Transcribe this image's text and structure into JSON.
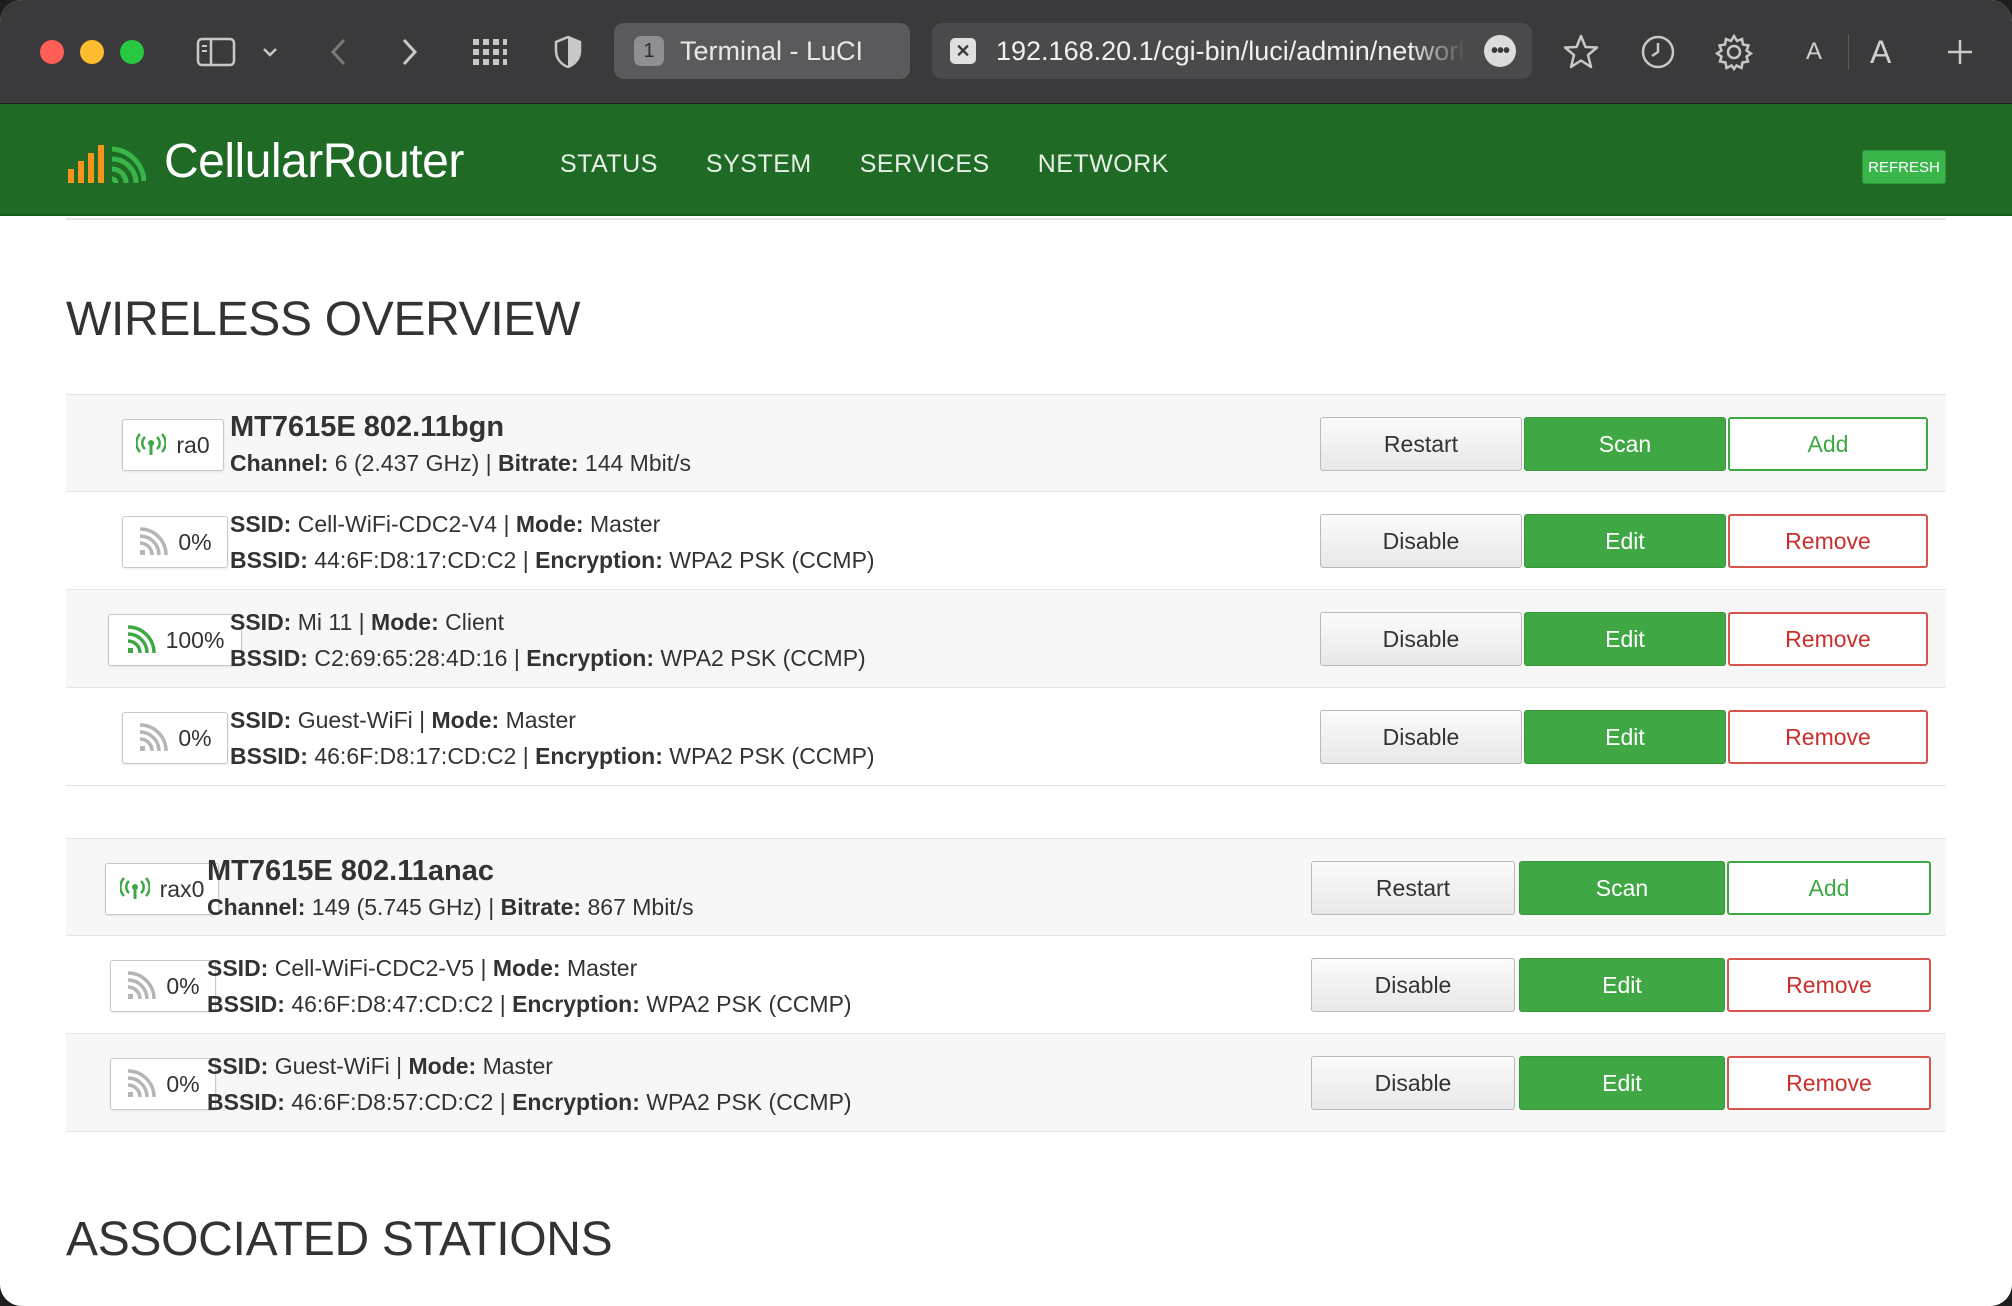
{
  "browser": {
    "tab": {
      "number": "1",
      "title": "Terminal - LuCI"
    },
    "url": "192.168.20.1/cgi-bin/luci/admin/network",
    "font_small": "A",
    "font_large": "A"
  },
  "header": {
    "brand": "CellularRouter",
    "nav": [
      "STATUS",
      "SYSTEM",
      "SERVICES",
      "NETWORK"
    ],
    "refresh": "REFRESH",
    "colors": {
      "bar": "#1f6b26",
      "accent": "#3fa845",
      "danger": "#d9534f"
    }
  },
  "page": {
    "title": "WIRELESS OVERVIEW",
    "stations_title": "ASSOCIATED STATIONS"
  },
  "labels": {
    "channel": "Channel:",
    "bitrate": "Bitrate:",
    "ssid": "SSID:",
    "mode": "Mode:",
    "bssid": "BSSID:",
    "encryption": "Encryption:",
    "restart": "Restart",
    "scan": "Scan",
    "add": "Add",
    "disable": "Disable",
    "edit": "Edit",
    "remove": "Remove"
  },
  "radios": [
    {
      "device": "ra0",
      "name": "MT7615E 802.11bgn",
      "channel": "6 (2.437 GHz)",
      "bitrate": "144 Mbit/s",
      "networks": [
        {
          "signal": "0%",
          "ssid": "Cell-WiFi-CDC2-V4",
          "mode": "Master",
          "bssid": "44:6F:D8:17:CD:C2",
          "encryption": "WPA2 PSK (CCMP)"
        },
        {
          "signal": "100%",
          "ssid": "Mi 11",
          "mode": "Client",
          "bssid": "C2:69:65:28:4D:16",
          "encryption": "WPA2 PSK (CCMP)"
        },
        {
          "signal": "0%",
          "ssid": "Guest-WiFi",
          "mode": "Master",
          "bssid": "46:6F:D8:17:CD:C2",
          "encryption": "WPA2 PSK (CCMP)"
        }
      ]
    },
    {
      "device": "rax0",
      "name": "MT7615E 802.11anac",
      "channel": "149 (5.745 GHz)",
      "bitrate": "867 Mbit/s",
      "networks": [
        {
          "signal": "0%",
          "ssid": "Cell-WiFi-CDC2-V5",
          "mode": "Master",
          "bssid": "46:6F:D8:47:CD:C2",
          "encryption": "WPA2 PSK (CCMP)"
        },
        {
          "signal": "0%",
          "ssid": "Guest-WiFi",
          "mode": "Master",
          "bssid": "46:6F:D8:57:CD:C2",
          "encryption": "WPA2 PSK (CCMP)"
        }
      ]
    }
  ]
}
